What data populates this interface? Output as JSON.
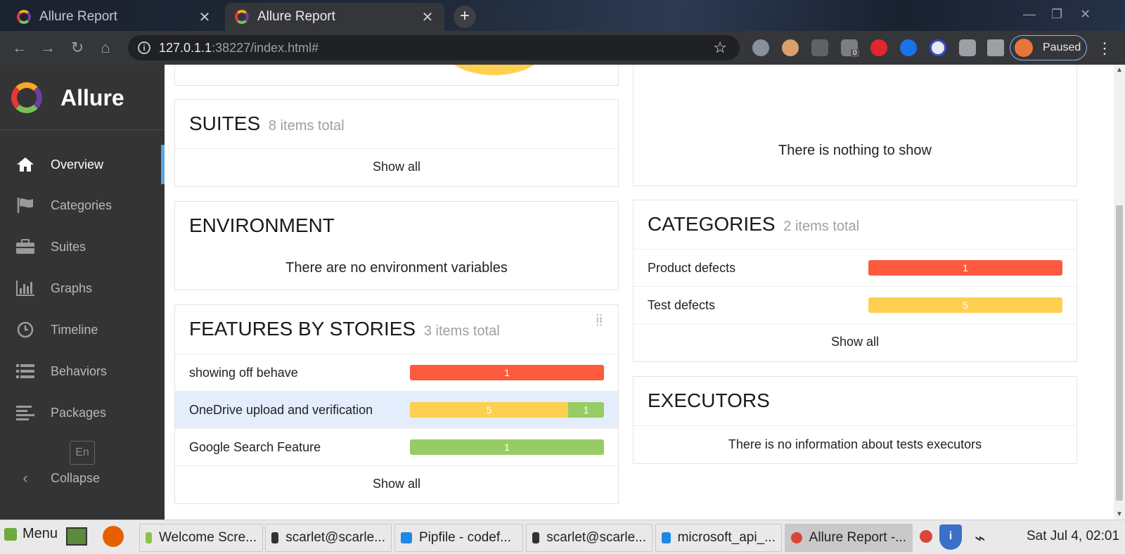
{
  "browser": {
    "tabs": [
      {
        "title": "Allure Report",
        "close": "✕"
      },
      {
        "title": "Allure Report",
        "close": "✕"
      }
    ],
    "new_tab": "+",
    "url_host": "127.0.1.1",
    "url_rest": ":38227/index.html#",
    "profile_status": "Paused",
    "window_controls": {
      "minimize": "—",
      "maximize": "❐",
      "close": "✕"
    },
    "extension_badge": "0"
  },
  "sidebar": {
    "brand": "Allure",
    "items": [
      {
        "label": "Overview",
        "icon": "home-icon"
      },
      {
        "label": "Categories",
        "icon": "flag-icon"
      },
      {
        "label": "Suites",
        "icon": "briefcase-icon"
      },
      {
        "label": "Graphs",
        "icon": "bar-chart-icon"
      },
      {
        "label": "Timeline",
        "icon": "clock-icon"
      },
      {
        "label": "Behaviors",
        "icon": "list-icon"
      },
      {
        "label": "Packages",
        "icon": "align-left-icon"
      }
    ],
    "language": "En",
    "collapse": "Collapse"
  },
  "widgets": {
    "suites": {
      "title": "SUITES",
      "count": "8 items total",
      "show_all": "Show all"
    },
    "environment": {
      "title": "ENVIRONMENT",
      "empty": "There are no environment variables"
    },
    "features": {
      "title": "FEATURES BY STORIES",
      "count": "3 items total",
      "rows": [
        {
          "name": "showing off behave",
          "segments": [
            {
              "status": "failed",
              "value": 1
            }
          ]
        },
        {
          "name": "OneDrive upload and verification",
          "segments": [
            {
              "status": "broken",
              "value": 5
            },
            {
              "status": "passed",
              "value": 1
            }
          ]
        },
        {
          "name": "Google Search Feature",
          "segments": [
            {
              "status": "passed",
              "value": 1
            }
          ]
        }
      ],
      "show_all": "Show all"
    },
    "trend": {
      "empty": "There is nothing to show"
    },
    "categories": {
      "title": "CATEGORIES",
      "count": "2 items total",
      "rows": [
        {
          "name": "Product defects",
          "segments": [
            {
              "status": "failed",
              "value": 1
            }
          ]
        },
        {
          "name": "Test defects",
          "segments": [
            {
              "status": "broken",
              "value": 5
            }
          ]
        }
      ],
      "show_all": "Show all"
    },
    "executors": {
      "title": "EXECUTORS",
      "empty": "There is no information about tests executors"
    }
  },
  "colors": {
    "failed": "#fd5a3e",
    "broken": "#ffd050",
    "passed": "#97cc64",
    "accent": "#5ea4e2"
  },
  "taskbar": {
    "menu": "Menu",
    "items": [
      "Welcome Scre...",
      "scarlet@scarle...",
      "Pipfile - codef...",
      "scarlet@scarle...",
      "microsoft_api_...",
      "Allure Report -..."
    ],
    "clock": "Sat Jul  4, 02:01"
  }
}
